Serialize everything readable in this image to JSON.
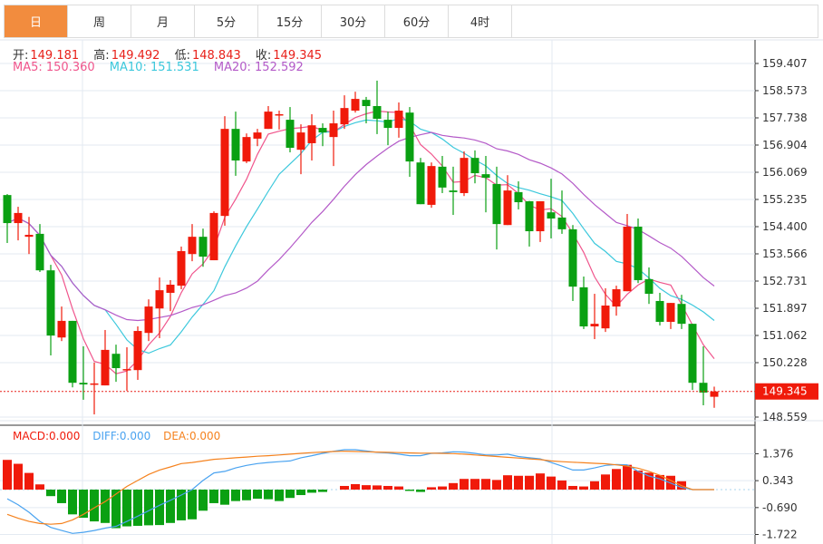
{
  "tabs": [
    "日",
    "周",
    "月",
    "5分",
    "15分",
    "30分",
    "60分",
    "4时"
  ],
  "active_tab": 0,
  "ohlc_info": {
    "open_label": "开:",
    "open": "149.181",
    "high_label": "高:",
    "high": "149.492",
    "low_label": "低:",
    "low": "148.843",
    "close_label": "收:",
    "close": "149.345"
  },
  "ma_info": {
    "ma5": "MA5: 150.360",
    "ma10": "MA10: 151.531",
    "ma20": "MA20: 152.592"
  },
  "macd_info": {
    "macd": "MACD:0.000",
    "diff": "DIFF:0.000",
    "dea": "DEA:0.000"
  },
  "colors": {
    "up": "#f01a0a",
    "down": "#0aa012",
    "ma5": "#f0558c",
    "ma10": "#3cc8dc",
    "ma20": "#b45ac8",
    "diff": "#4aa3f0",
    "dea": "#f5821e",
    "tab_active": "#f28c3e"
  },
  "chart_data": {
    "type": "candlestick",
    "price_axis": {
      "min": 148.559,
      "max": 159.407,
      "ticks": [
        "159.407",
        "158.573",
        "157.738",
        "156.904",
        "156.069",
        "155.235",
        "154.400",
        "153.566",
        "152.731",
        "151.897",
        "151.062",
        "150.228",
        "148.559"
      ],
      "ticks_values": [
        159.407,
        158.573,
        157.738,
        156.904,
        156.069,
        155.235,
        154.4,
        153.566,
        152.731,
        151.897,
        151.062,
        150.228,
        148.559
      ]
    },
    "last_price": "149.345",
    "last_price_value": 149.345,
    "ohlc": [
      [
        155.37,
        155.4,
        153.9,
        154.51
      ],
      [
        154.51,
        155.01,
        153.98,
        154.82
      ],
      [
        154.09,
        154.7,
        153.56,
        154.15
      ],
      [
        154.18,
        154.48,
        153.01,
        153.06
      ],
      [
        153.06,
        153.23,
        150.45,
        151.06
      ],
      [
        151.0,
        151.95,
        150.89,
        151.51
      ],
      [
        151.51,
        151.51,
        149.47,
        149.61
      ],
      [
        149.61,
        150.73,
        149.09,
        149.56
      ],
      [
        149.56,
        150.23,
        148.64,
        149.59
      ],
      [
        149.53,
        151.23,
        149.53,
        150.62
      ],
      [
        150.5,
        150.78,
        149.64,
        150.06
      ],
      [
        150.0,
        150.7,
        149.36,
        150.03
      ],
      [
        150.0,
        151.34,
        149.7,
        151.2
      ],
      [
        151.14,
        152.17,
        150.89,
        151.95
      ],
      [
        151.89,
        152.84,
        150.98,
        152.45
      ],
      [
        152.37,
        152.76,
        151.81,
        152.62
      ],
      [
        152.59,
        153.79,
        152.48,
        153.65
      ],
      [
        153.56,
        154.48,
        153.34,
        154.09
      ],
      [
        154.09,
        154.34,
        153.17,
        153.48
      ],
      [
        153.37,
        154.87,
        153.37,
        154.82
      ],
      [
        154.73,
        157.79,
        154.43,
        157.4
      ],
      [
        157.4,
        157.93,
        155.96,
        156.43
      ],
      [
        156.4,
        157.26,
        156.35,
        157.15
      ],
      [
        157.1,
        157.4,
        156.87,
        157.29
      ],
      [
        157.4,
        158.1,
        157.4,
        157.93
      ],
      [
        157.82,
        157.96,
        157.38,
        157.85
      ],
      [
        157.68,
        158.07,
        156.68,
        156.82
      ],
      [
        156.76,
        157.54,
        156.01,
        157.29
      ],
      [
        156.96,
        157.85,
        156.43,
        157.51
      ],
      [
        157.43,
        157.57,
        156.87,
        157.29
      ],
      [
        157.15,
        157.96,
        156.26,
        157.57
      ],
      [
        157.54,
        158.43,
        157.4,
        158.04
      ],
      [
        157.96,
        158.54,
        157.9,
        158.32
      ],
      [
        158.29,
        158.38,
        157.57,
        158.1
      ],
      [
        158.1,
        158.88,
        157.24,
        157.71
      ],
      [
        157.68,
        157.93,
        156.9,
        157.43
      ],
      [
        157.43,
        158.21,
        157.13,
        157.96
      ],
      [
        157.9,
        158.07,
        155.93,
        156.4
      ],
      [
        156.37,
        156.51,
        155.09,
        155.09
      ],
      [
        155.07,
        156.37,
        154.98,
        156.26
      ],
      [
        156.24,
        156.57,
        155.43,
        155.6
      ],
      [
        155.51,
        156.24,
        154.76,
        155.46
      ],
      [
        155.43,
        156.71,
        155.34,
        156.51
      ],
      [
        156.51,
        156.74,
        155.73,
        156.04
      ],
      [
        156.01,
        156.57,
        154.84,
        155.9
      ],
      [
        155.71,
        156.24,
        153.7,
        154.48
      ],
      [
        154.45,
        155.98,
        154.45,
        155.51
      ],
      [
        155.46,
        155.79,
        154.93,
        155.15
      ],
      [
        155.18,
        155.19,
        153.79,
        154.26
      ],
      [
        154.26,
        155.18,
        153.93,
        155.18
      ],
      [
        154.84,
        155.87,
        154.04,
        154.65
      ],
      [
        154.68,
        155.51,
        154.18,
        154.32
      ],
      [
        154.32,
        154.45,
        152.12,
        152.56
      ],
      [
        152.54,
        152.87,
        151.26,
        151.34
      ],
      [
        151.34,
        152.34,
        150.95,
        151.42
      ],
      [
        151.28,
        152.51,
        151.17,
        151.98
      ],
      [
        151.95,
        152.59,
        151.67,
        152.48
      ],
      [
        152.42,
        154.79,
        152.42,
        154.4
      ],
      [
        154.4,
        154.65,
        152.67,
        152.76
      ],
      [
        152.79,
        153.15,
        152.03,
        152.34
      ],
      [
        152.12,
        152.37,
        151.37,
        151.48
      ],
      [
        151.48,
        152.06,
        151.26,
        152.06
      ],
      [
        152.03,
        152.31,
        151.26,
        151.42
      ],
      [
        151.42,
        151.42,
        149.39,
        149.61
      ],
      [
        149.61,
        150.73,
        148.92,
        149.31
      ],
      [
        149.181,
        149.492,
        148.843,
        149.345
      ]
    ],
    "ma_periods": [
      5,
      10,
      20
    ],
    "macd_axis": {
      "ticks": [
        "1.376",
        "0.343",
        "-0.690",
        "-1.722"
      ],
      "ticks_values": [
        1.376,
        0.343,
        -0.69,
        -1.722
      ]
    },
    "macd_hist": [
      1.14,
      0.99,
      0.64,
      0.2,
      -0.25,
      -0.52,
      -0.95,
      -1.08,
      -1.22,
      -1.28,
      -1.48,
      -1.41,
      -1.39,
      -1.37,
      -1.36,
      -1.28,
      -1.18,
      -1.14,
      -0.81,
      -0.52,
      -0.58,
      -0.44,
      -0.41,
      -0.35,
      -0.37,
      -0.44,
      -0.32,
      -0.21,
      -0.12,
      -0.09,
      0,
      0.14,
      0.21,
      0.17,
      0.16,
      0.14,
      0.12,
      -0.05,
      -0.09,
      0.09,
      0.12,
      0.25,
      0.41,
      0.41,
      0.41,
      0.37,
      0.55,
      0.53,
      0.53,
      0.62,
      0.5,
      0.35,
      0.14,
      0.12,
      0.32,
      0.58,
      0.79,
      0.95,
      0.73,
      0.65,
      0.56,
      0.53,
      0.32,
      0,
      0,
      0
    ],
    "diff": [
      -0.35,
      -0.58,
      -0.87,
      -1.22,
      -1.45,
      -1.57,
      -1.68,
      -1.64,
      -1.57,
      -1.48,
      -1.41,
      -1.22,
      -1.02,
      -0.81,
      -0.6,
      -0.41,
      -0.21,
      0.0,
      0.35,
      0.64,
      0.7,
      0.83,
      0.93,
      1.0,
      1.04,
      1.07,
      1.1,
      1.22,
      1.3,
      1.39,
      1.47,
      1.53,
      1.53,
      1.48,
      1.43,
      1.41,
      1.36,
      1.3,
      1.3,
      1.39,
      1.41,
      1.45,
      1.44,
      1.39,
      1.33,
      1.33,
      1.36,
      1.27,
      1.22,
      1.18,
      1.04,
      0.9,
      0.75,
      0.75,
      0.83,
      0.93,
      0.96,
      0.95,
      0.7,
      0.52,
      0.41,
      0.25,
      0.08,
      0,
      0,
      0
    ],
    "dea": [
      -0.95,
      -1.1,
      -1.22,
      -1.3,
      -1.33,
      -1.3,
      -1.16,
      -0.95,
      -0.7,
      -0.46,
      -0.17,
      0.12,
      0.35,
      0.58,
      0.75,
      0.87,
      1.0,
      1.04,
      1.1,
      1.16,
      1.19,
      1.22,
      1.25,
      1.28,
      1.3,
      1.33,
      1.36,
      1.39,
      1.42,
      1.44,
      1.46,
      1.47,
      1.46,
      1.45,
      1.44,
      1.43,
      1.42,
      1.41,
      1.4,
      1.4,
      1.39,
      1.38,
      1.36,
      1.33,
      1.3,
      1.27,
      1.24,
      1.21,
      1.18,
      1.15,
      1.1,
      1.07,
      1.05,
      1.03,
      1.01,
      0.99,
      0.95,
      0.9,
      0.82,
      0.7,
      0.55,
      0.35,
      0.15,
      0,
      0,
      0
    ]
  }
}
